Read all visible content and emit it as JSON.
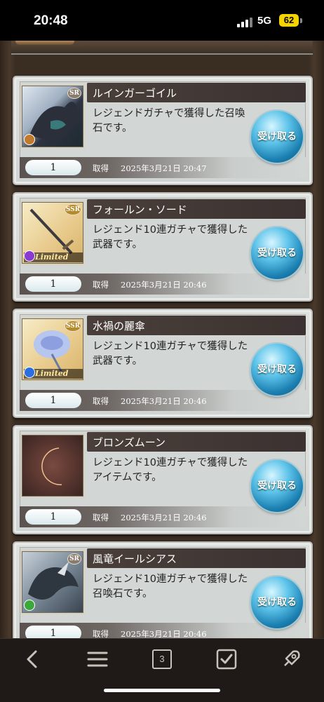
{
  "status": {
    "time": "20:48",
    "network": "5G",
    "battery": "62"
  },
  "items": [
    {
      "name": "ルインガーゴイル",
      "rarity": "SR",
      "description": "レジェンドガチャで獲得した召喚石です。",
      "count": "1",
      "acquired_label": "取得",
      "acquired_time": "2025年3月21日 20:47",
      "button": "受け取る",
      "limited": "",
      "element_color": "#c07a2a"
    },
    {
      "name": "フォールン・ソード",
      "rarity": "SSR",
      "description": "レジェンド10連ガチャで獲得した武器です。",
      "count": "1",
      "acquired_label": "取得",
      "acquired_time": "2025年3月21日 20:46",
      "button": "受け取る",
      "limited": "Limited",
      "element_color": "#8a3ad0"
    },
    {
      "name": "水禍の麗傘",
      "rarity": "SSR",
      "description": "レジェンド10連ガチャで獲得した武器です。",
      "count": "1",
      "acquired_label": "取得",
      "acquired_time": "2025年3月21日 20:46",
      "button": "受け取る",
      "limited": "Limited",
      "element_color": "#2a6ee0"
    },
    {
      "name": "ブロンズムーン",
      "rarity": "",
      "description": "レジェンド10連ガチャで獲得したアイテムです。",
      "count": "1",
      "acquired_label": "取得",
      "acquired_time": "2025年3月21日 20:46",
      "button": "受け取る",
      "limited": "",
      "element_color": ""
    },
    {
      "name": "風竜イールシアス",
      "rarity": "SR",
      "description": "レジェンド10連ガチャで獲得した召喚石です。",
      "count": "1",
      "acquired_label": "取得",
      "acquired_time": "2025年3月21日 20:46",
      "button": "受け取る",
      "limited": "",
      "element_color": "#3aa83a"
    }
  ],
  "nav": {
    "tabs_count": "3"
  }
}
